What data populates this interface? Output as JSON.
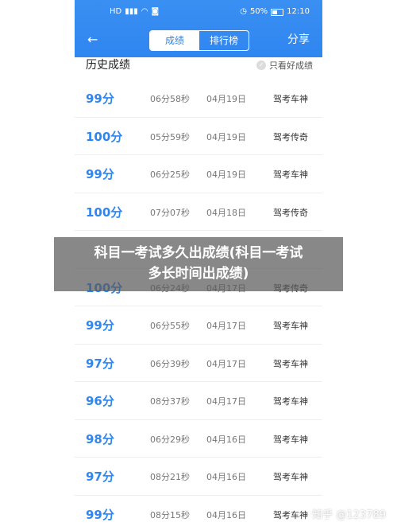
{
  "status_bar": {
    "left_icons": [
      "HD",
      "4G",
      "signal",
      "wifi",
      "nfc"
    ],
    "battery": "50%",
    "time": "12:10"
  },
  "header": {
    "back_icon": "←",
    "tabs": [
      {
        "label": "成绩",
        "active": true
      },
      {
        "label": "排行榜",
        "active": false
      }
    ],
    "share_label": "分享",
    "color": "#2f86ef"
  },
  "section": {
    "title": "历史成绩",
    "filter_label": "只看好成绩",
    "filter_checked": false
  },
  "records": [
    {
      "score": "99分",
      "duration": "06分58秒",
      "date": "04月19日",
      "tag": "驾考车神"
    },
    {
      "score": "100分",
      "duration": "05分59秒",
      "date": "04月19日",
      "tag": "驾考传奇"
    },
    {
      "score": "99分",
      "duration": "06分25秒",
      "date": "04月19日",
      "tag": "驾考车神"
    },
    {
      "score": "100分",
      "duration": "07分07秒",
      "date": "04月18日",
      "tag": "驾考传奇"
    },
    {
      "score": "",
      "duration": "",
      "date": "",
      "tag": ""
    },
    {
      "score": "100分",
      "duration": "06分24秒",
      "date": "04月17日",
      "tag": "驾考传奇"
    },
    {
      "score": "99分",
      "duration": "06分55秒",
      "date": "04月17日",
      "tag": "驾考车神"
    },
    {
      "score": "97分",
      "duration": "06分39秒",
      "date": "04月17日",
      "tag": "驾考车神"
    },
    {
      "score": "96分",
      "duration": "08分37秒",
      "date": "04月17日",
      "tag": "驾考车神"
    },
    {
      "score": "98分",
      "duration": "06分29秒",
      "date": "04月16日",
      "tag": "驾考车神"
    },
    {
      "score": "97分",
      "duration": "08分21秒",
      "date": "04月16日",
      "tag": "驾考车神"
    },
    {
      "score": "99分",
      "duration": "08分15秒",
      "date": "04月16日",
      "tag": "驾考车神"
    }
  ],
  "overlay": {
    "line1": "科目一考试多久出成绩(科目一考试",
    "line2": "多长时间出成绩)"
  },
  "watermark": "知乎 @123789"
}
